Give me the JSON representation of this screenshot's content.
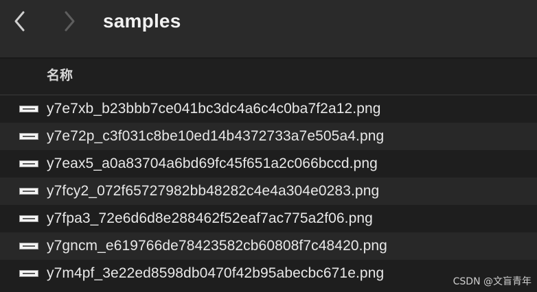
{
  "toolbar": {
    "back_icon": "chevron-left-icon",
    "forward_icon": "chevron-right-icon",
    "folder_title": "samples"
  },
  "columns": {
    "name_header": "名称"
  },
  "files": [
    {
      "name": "y7e7xb_b23bbb7ce041bc3dc4a6c4c0ba7f2a12.png",
      "icon": "png-file-icon"
    },
    {
      "name": "y7e72p_c3f031c8be10ed14b4372733a7e505a4.png",
      "icon": "png-file-icon"
    },
    {
      "name": "y7eax5_a0a83704a6bd69fc45f651a2c066bccd.png",
      "icon": "png-file-icon"
    },
    {
      "name": "y7fcy2_072f65727982bb48282c4e4a304e0283.png",
      "icon": "png-file-icon"
    },
    {
      "name": "y7fpa3_72e6d6d8e288462f52eaf7ac775a2f06.png",
      "icon": "png-file-icon"
    },
    {
      "name": "y7gncm_e619766de78423582cb60808f7c48420.png",
      "icon": "png-file-icon"
    },
    {
      "name": "y7m4pf_3e22ed8598db0470f42b95abecbc671e.png",
      "icon": "png-file-icon"
    }
  ],
  "watermark": "CSDN @文盲青年",
  "colors": {
    "toolbar_bg": "#2a2a2a",
    "row_odd": "#1e1e1e",
    "row_even": "#282828",
    "text": "#e8e8e8"
  }
}
